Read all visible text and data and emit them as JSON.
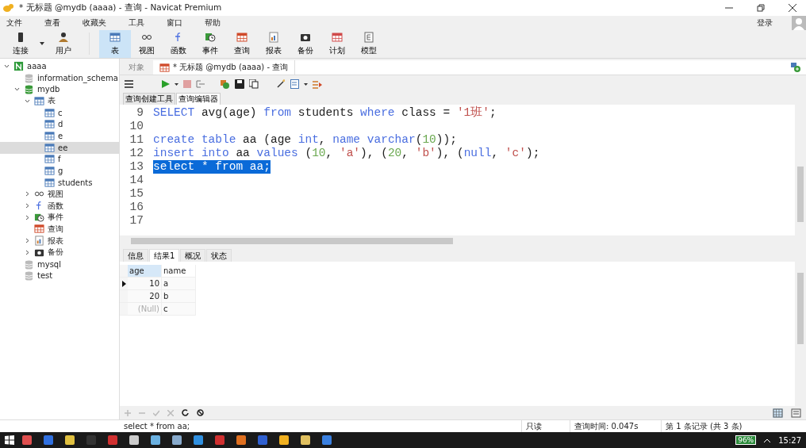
{
  "window": {
    "title": "* 无标题 @mydb (aaaa) - 查询 - Navicat Premium"
  },
  "menu": [
    "文件",
    "查看",
    "收藏夹",
    "工具",
    "窗口",
    "帮助"
  ],
  "login": "登录",
  "toolbar": [
    {
      "label": "连接",
      "kind": "connect",
      "selected": false,
      "dropdown": true
    },
    {
      "label": "用户",
      "kind": "user",
      "selected": false,
      "dropdown": false
    },
    {
      "label": "表",
      "kind": "table",
      "selected": true,
      "dropdown": false
    },
    {
      "label": "视图",
      "kind": "view",
      "selected": false,
      "dropdown": false
    },
    {
      "label": "函数",
      "kind": "function",
      "selected": false,
      "dropdown": false
    },
    {
      "label": "事件",
      "kind": "event",
      "selected": false,
      "dropdown": false
    },
    {
      "label": "查询",
      "kind": "query",
      "selected": false,
      "dropdown": false
    },
    {
      "label": "报表",
      "kind": "report",
      "selected": false,
      "dropdown": false
    },
    {
      "label": "备份",
      "kind": "backup",
      "selected": false,
      "dropdown": false
    },
    {
      "label": "计划",
      "kind": "schedule",
      "selected": false,
      "dropdown": false
    },
    {
      "label": "模型",
      "kind": "model",
      "selected": false,
      "dropdown": false
    }
  ],
  "tree": [
    {
      "label": "aaaa",
      "kind": "connection",
      "expanded": true,
      "selected": false,
      "children": [
        {
          "label": "information_schema",
          "kind": "db-off",
          "selected": false
        },
        {
          "label": "mydb",
          "kind": "db",
          "expanded": true,
          "selected": false,
          "children": [
            {
              "label": "表",
              "kind": "table",
              "expanded": true,
              "selected": false,
              "children": [
                {
                  "label": "c",
                  "kind": "table",
                  "selected": false
                },
                {
                  "label": "d",
                  "kind": "table",
                  "selected": false
                },
                {
                  "label": "e",
                  "kind": "table",
                  "selected": false
                },
                {
                  "label": "ee",
                  "kind": "table",
                  "selected": true
                },
                {
                  "label": "f",
                  "kind": "table",
                  "selected": false
                },
                {
                  "label": "g",
                  "kind": "table",
                  "selected": false
                },
                {
                  "label": "students",
                  "kind": "table",
                  "selected": false
                }
              ]
            },
            {
              "label": "视图",
              "kind": "view",
              "expanded": false,
              "selected": false
            },
            {
              "label": "函数",
              "kind": "function",
              "expanded": false,
              "selected": false
            },
            {
              "label": "事件",
              "kind": "event",
              "expanded": false,
              "selected": false
            },
            {
              "label": "查询",
              "kind": "query",
              "selected": false
            },
            {
              "label": "报表",
              "kind": "report",
              "expanded": false,
              "selected": false
            },
            {
              "label": "备份",
              "kind": "backup",
              "expanded": false,
              "selected": false
            }
          ]
        },
        {
          "label": "mysql",
          "kind": "db-off",
          "selected": false
        },
        {
          "label": "test",
          "kind": "db-off",
          "selected": false
        }
      ]
    }
  ],
  "doc_tabs": [
    {
      "label": "对象",
      "selected": false,
      "kind": "objects"
    },
    {
      "label": "* 无标题 @mydb (aaaa) - 查询",
      "selected": true,
      "kind": "query"
    }
  ],
  "editor_tabs": [
    {
      "label": "查询创建工具",
      "selected": false
    },
    {
      "label": "查询编辑器",
      "selected": true
    }
  ],
  "code": [
    {
      "no": "9",
      "selected": false,
      "tokens": [
        {
          "t": "SELECT",
          "kind": "kw"
        },
        {
          "t": " avg(age) ",
          "kind": "id"
        },
        {
          "t": "from",
          "kind": "kw"
        },
        {
          "t": " students ",
          "kind": "id"
        },
        {
          "t": "where",
          "kind": "kw"
        },
        {
          "t": " class = ",
          "kind": "id"
        },
        {
          "t": "'1班'",
          "kind": "str"
        },
        {
          "t": ";",
          "kind": "id"
        }
      ]
    },
    {
      "no": "10",
      "selected": false
    },
    {
      "no": "11",
      "selected": false,
      "tokens": [
        {
          "t": "create table",
          "kind": "kw"
        },
        {
          "t": " aa (age ",
          "kind": "id"
        },
        {
          "t": "int",
          "kind": "kw"
        },
        {
          "t": ", ",
          "kind": "id"
        },
        {
          "t": "name varchar",
          "kind": "kw"
        },
        {
          "t": "(",
          "kind": "id"
        },
        {
          "t": "10",
          "kind": "num"
        },
        {
          "t": "));",
          "kind": "id"
        }
      ]
    },
    {
      "no": "12",
      "selected": false,
      "tokens": [
        {
          "t": "insert into",
          "kind": "kw"
        },
        {
          "t": " aa ",
          "kind": "id"
        },
        {
          "t": "values",
          "kind": "kw"
        },
        {
          "t": " (",
          "kind": "id"
        },
        {
          "t": "10",
          "kind": "num"
        },
        {
          "t": ", ",
          "kind": "id"
        },
        {
          "t": "'a'",
          "kind": "str"
        },
        {
          "t": "), (",
          "kind": "id"
        },
        {
          "t": "20",
          "kind": "num"
        },
        {
          "t": ", ",
          "kind": "id"
        },
        {
          "t": "'b'",
          "kind": "str"
        },
        {
          "t": "), (",
          "kind": "id"
        },
        {
          "t": "null",
          "kind": "kw"
        },
        {
          "t": ", ",
          "kind": "id"
        },
        {
          "t": "'c'",
          "kind": "str"
        },
        {
          "t": ");",
          "kind": "id"
        }
      ]
    },
    {
      "no": "13",
      "selected": true,
      "tokens": [
        {
          "t": "select * from aa;",
          "kind": "id"
        }
      ]
    },
    {
      "no": "14",
      "selected": false
    },
    {
      "no": "15",
      "selected": false
    },
    {
      "no": "16",
      "selected": false
    },
    {
      "no": "17",
      "selected": false
    }
  ],
  "result_tabs": [
    {
      "label": "信息",
      "selected": false
    },
    {
      "label": "结果1",
      "selected": true
    },
    {
      "label": "概况",
      "selected": false
    },
    {
      "label": "状态",
      "selected": false
    }
  ],
  "grid": {
    "columns": [
      {
        "label": "age",
        "selected": true
      },
      {
        "label": "name",
        "selected": false
      }
    ],
    "rows": [
      {
        "current": true,
        "cells": [
          {
            "text": "10",
            "null": false
          },
          {
            "text": "a",
            "null": false
          }
        ]
      },
      {
        "current": false,
        "cells": [
          {
            "text": "20",
            "null": false
          },
          {
            "text": "b",
            "null": false
          }
        ]
      },
      {
        "current": false,
        "cells": [
          {
            "text": "(Null)",
            "null": true
          },
          {
            "text": "c",
            "null": false
          }
        ]
      }
    ]
  },
  "status_bar": {
    "sql": "select * from aa;",
    "mode": "只读",
    "time": "查询时间: 0.047s",
    "record": "第 1 条记录 (共 3 条)"
  },
  "taskbar": {
    "battery": "96%",
    "clock": "15:27"
  }
}
